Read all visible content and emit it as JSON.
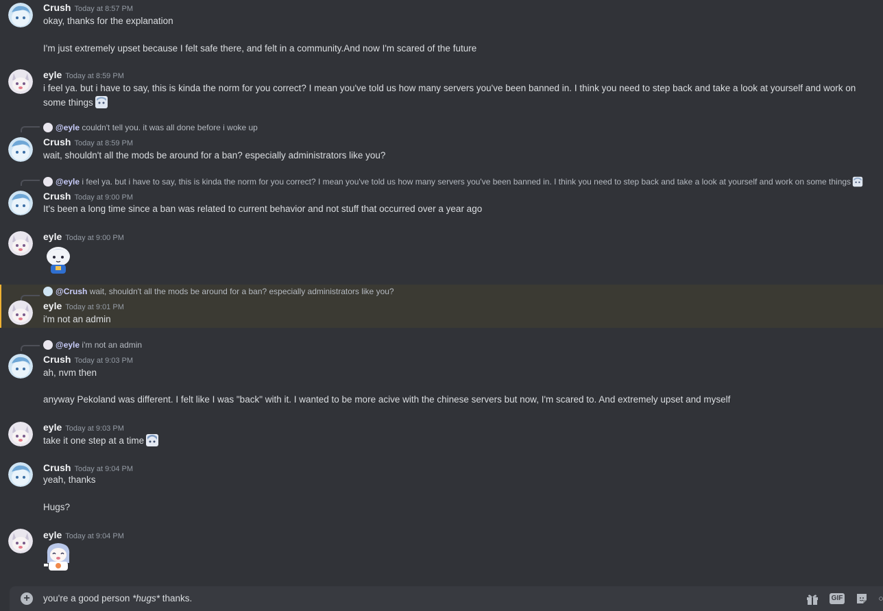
{
  "messages": [
    {
      "author": "Crush",
      "time": "Today at 8:57 PM",
      "lines": [
        "okay, thanks for the explanation",
        "I'm just extremely upset because  I felt safe there, and felt in a community.And now I'm scared of the future"
      ]
    },
    {
      "author": "eyle",
      "time": "Today at 8:59 PM",
      "text": "i feel ya. but i have to say, this is kinda the norm for you correct? I mean you've told us how many servers you've been banned in. I think you need to step back and take a look at yourself and work on some things"
    },
    {
      "reply": {
        "mention": "@eyle",
        "text": "couldn't tell you. it was all done before i woke up"
      },
      "author": "Crush",
      "time": "Today at 8:59 PM",
      "text": "wait, shouldn't all the mods be around for a ban? especially administrators like you?"
    },
    {
      "reply": {
        "mention": "@eyle",
        "text": "i feel ya. but i have to say, this is kinda the norm for you correct? I mean you've told us how many servers you've been banned in. I think you need to step back and take a look at yourself and work on some things"
      },
      "author": "Crush",
      "time": "Today at 9:00 PM",
      "text": "It's been a long time since a ban was related to current behavior and not stuff that occurred over a year ago"
    },
    {
      "author": "eyle",
      "time": "Today at 9:00 PM"
    },
    {
      "reply": {
        "mention": "@Crush",
        "text": "wait, shouldn't all the mods be around for a ban? especially administrators like you?"
      },
      "author": "eyle",
      "time": "Today at 9:01 PM",
      "text": "i'm not an admin"
    },
    {
      "reply": {
        "mention": "@eyle",
        "text": "i'm not an admin"
      },
      "author": "Crush",
      "time": "Today at 9:03 PM",
      "lines": [
        "ah, nvm then",
        "anyway Pekoland was different. I felt like I was \"back\" with it. I wanted to be more acive with the chinese servers but now, I'm scared to. And extremely upset and myself"
      ]
    },
    {
      "author": "eyle",
      "time": "Today at 9:03 PM",
      "text": "take it one step at a time"
    },
    {
      "author": "Crush",
      "time": "Today at 9:04 PM",
      "lines": [
        "yeah, thanks",
        "Hugs?"
      ]
    },
    {
      "author": "eyle",
      "time": "Today at 9:04 PM"
    }
  ],
  "composer": {
    "before": "you're a good person ",
    "italic": "*hugs*",
    "after": " thanks."
  },
  "icons": {
    "add": "plus-circle-icon",
    "gift": "gift-icon",
    "gif": "GIF",
    "sticker": "sticker-icon"
  },
  "colors": {
    "background": "#313338",
    "highlight": "#3b3a33",
    "highlight_border": "#f0b232",
    "mention": "#c9cdfb"
  }
}
